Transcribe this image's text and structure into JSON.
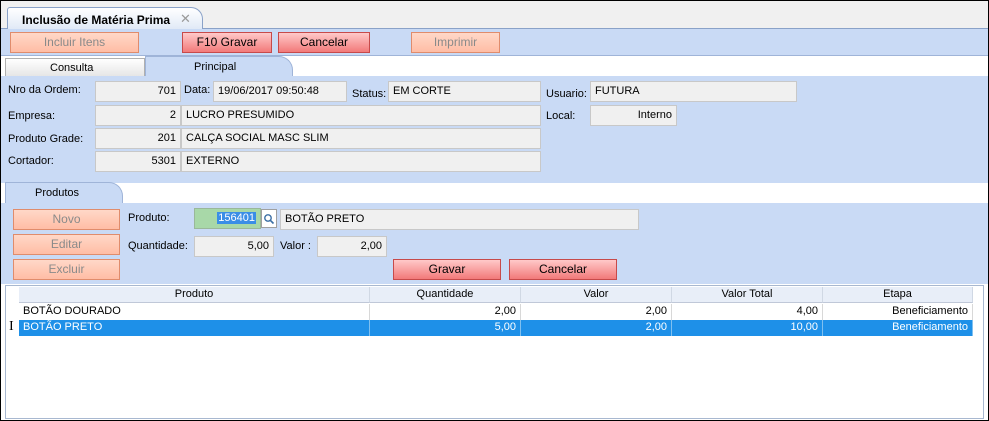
{
  "window": {
    "tab_title": "Inclusão de Matéria Prima",
    "close_glyph": "✕"
  },
  "toolbar": {
    "incluir": "Incluir Itens",
    "gravar": "F10 Gravar",
    "cancelar": "Cancelar",
    "imprimir": "Imprimir"
  },
  "tabs": {
    "consulta": "Consulta",
    "principal": "Principal"
  },
  "form": {
    "nro_label": "Nro da Ordem:",
    "nro_value": "701",
    "data_label": "Data:",
    "data_value": "19/06/2017 09:50:48",
    "status_label": "Status:",
    "status_value": "EM CORTE",
    "usuario_label": "Usuario:",
    "usuario_value": "FUTURA",
    "empresa_label": "Empresa:",
    "empresa_code": "2",
    "empresa_name": "LUCRO PRESUMIDO",
    "local_label": "Local:",
    "local_value": "Interno",
    "produto_label": "Produto Grade:",
    "produto_code": "201",
    "produto_name": "CALÇA SOCIAL MASC SLIM",
    "cortador_label": "Cortador:",
    "cortador_code": "5301",
    "cortador_name": "EXTERNO"
  },
  "produtos": {
    "tab_label": "Produtos",
    "novo": "Novo",
    "editar": "Editar",
    "excluir": "Excluir",
    "produto_label": "Produto:",
    "produto_code": "156401",
    "produto_name": "BOTÃO PRETO",
    "quantidade_label": "Quantidade:",
    "quantidade_value": "5,00",
    "valor_label": "Valor :",
    "valor_value": "2,00",
    "gravar": "Gravar",
    "cancelar": "Cancelar"
  },
  "grid": {
    "headers": [
      "Produto",
      "Quantidade",
      "Valor",
      "Valor Total",
      "Etapa"
    ],
    "rows": [
      [
        "BOTÃO DOURADO",
        "2,00",
        "2,00",
        "4,00",
        "Beneficiamento"
      ],
      [
        "BOTÃO PRETO",
        "5,00",
        "2,00",
        "10,00",
        "Beneficiamento"
      ]
    ],
    "cursor_glyph": "I"
  },
  "colors": {
    "panel": "#c9daf5",
    "selection": "#1e90e8",
    "button": "#ff9f7d"
  }
}
